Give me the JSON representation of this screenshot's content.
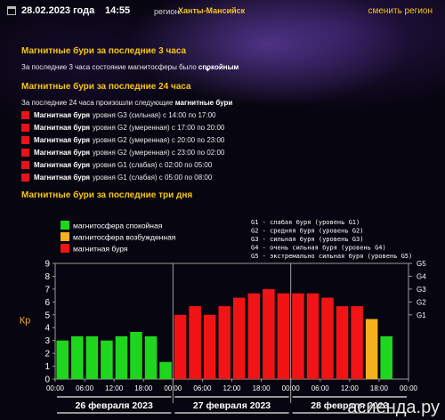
{
  "header": {
    "date": "28.02.2023 года",
    "time": "14:55",
    "region_label": "регион:",
    "region_name": "Ханты-Мансийск",
    "change_region": "сменить регион"
  },
  "section3h": {
    "title": "Магнитные бури за последние 3 часа",
    "text_prefix": "За последние 3 часа состояние магнитосферы было",
    "text_bold": "спокойным"
  },
  "section24h": {
    "title": "Магнитные бури за последние 24 часа",
    "text_prefix": "За последние 24 часа произошли следующие",
    "text_bold": "магнитные бури",
    "items": [
      {
        "title": "Магнитная буря",
        "desc": "уровня G3 (сильная) с 14:00 по 17:00"
      },
      {
        "title": "Магнитная буря",
        "desc": "уровня G2 (умеренная) с 17:00 по 20:00"
      },
      {
        "title": "Магнитная буря",
        "desc": "уровня G2 (умеренная) с 20:00 по 23:00"
      },
      {
        "title": "Магнитная буря",
        "desc": "уровня G2 (умеренная) с 23:00 по 02:00"
      },
      {
        "title": "Магнитная буря",
        "desc": "уровня G1 (слабая) с 02:00 по 05:00"
      },
      {
        "title": "Магнитная буря",
        "desc": "уровня G1 (слабая) с 05:00 по 08:00"
      }
    ]
  },
  "section3d": {
    "title": "Магнитные бури за последние три дня"
  },
  "colors": {
    "quiet": "#1ed61e",
    "active": "#f5b01e",
    "storm": "#f01414",
    "accent": "#f5c518"
  },
  "chart_data": {
    "type": "bar",
    "ylabel": "Кр",
    "ylim": [
      0,
      9
    ],
    "yticks": [
      "0",
      "1",
      "2",
      "3",
      "4",
      "5",
      "6",
      "7",
      "8",
      "9"
    ],
    "g_ticks": [
      {
        "value": 5,
        "label": "G1"
      },
      {
        "value": 6,
        "label": "G2"
      },
      {
        "value": 7,
        "label": "G3"
      },
      {
        "value": 8,
        "label": "G4"
      },
      {
        "value": 9,
        "label": "G5"
      }
    ],
    "legend": [
      {
        "label": "магнитосфера спокойная",
        "status": "quiet"
      },
      {
        "label": "магнитосфера возбужденная",
        "status": "active"
      },
      {
        "label": "магнитная буря",
        "status": "storm"
      }
    ],
    "g_legend": [
      "G1 - слабая буря (уровень G1)",
      "G2 - средняя буря (уровень G2)",
      "G3 - сильная буря (уровень G3)",
      "G4 - очень сильная буря (уровень G4)",
      "G5 - экстремально сильная буря (уровень G5)"
    ],
    "tick_labels": [
      "00:00",
      "06:00",
      "12:00",
      "18:00",
      "00:00",
      "06:00",
      "12:00",
      "18:00",
      "00:00",
      "06:00",
      "12:00",
      "18:00",
      "00:00"
    ],
    "days": [
      "26 февраля 2023",
      "27 февраля 2023",
      "28 февраля 2023"
    ],
    "values": [
      3.0,
      3.33,
      3.33,
      3.0,
      3.33,
      3.67,
      3.33,
      1.33,
      5.0,
      5.67,
      5.0,
      5.67,
      6.33,
      6.67,
      7.0,
      6.67,
      6.67,
      6.67,
      6.33,
      5.67,
      5.67,
      4.67,
      3.33
    ],
    "statuses": [
      "quiet",
      "quiet",
      "quiet",
      "quiet",
      "quiet",
      "quiet",
      "quiet",
      "quiet",
      "storm",
      "storm",
      "storm",
      "storm",
      "storm",
      "storm",
      "storm",
      "storm",
      "storm",
      "storm",
      "storm",
      "storm",
      "storm",
      "active",
      "quiet"
    ]
  },
  "watermark": "асиенда.ру"
}
